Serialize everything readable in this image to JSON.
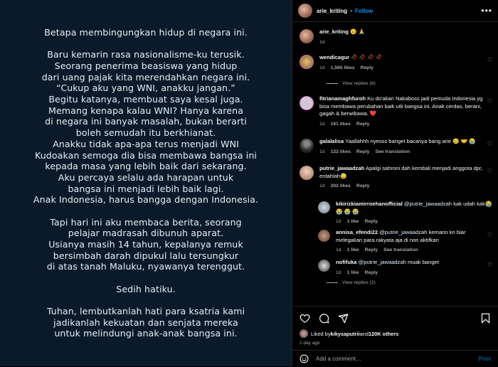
{
  "post": {
    "paragraphs": [
      "Betapa membingungkan hidup di negara ini.",
      "Baru kemarin rasa nasionalisme-ku terusik.\nSeorang penerima beasiswa yang hidup\ndari uang pajak kita merendahkan negara ini.\n“Cukup aku yang WNI, anakku jangan.”\nBegitu katanya, membuat saya kesal juga.\nMemang kenapa kalau WNI? Hanya karena\ndi negara ini banyak masalah, bukan berarti\nboleh semudah itu berkhianat.\nAnakku tidak apa-apa terus menjadi WNI\nKudoakan semoga dia bisa membawa bangsa ini\nkepada masa yang lebih baik dari sekarang.\nAku percaya selalu ada harapan untuk\nbangsa ini menjadi lebih baik lagi.\nAnak Indonesia, harus bangga dengan Indonesia.",
      "Tapi hari ini aku membaca berita, seorang\npelajar madrasah dibunuh aparat.\nUsianya masih 14 tahun, kepalanya remuk\nbersimbah darah dipukul lalu tersungkur\ndi atas tanah Maluku, nyawanya terenggut.",
      "Sedih hatiku.",
      "Tuhan, lembutkanlah hati para ksatria kami\njadikanlah kekuatan dan senjata mereka\nuntuk melindungi anak-anak bangsa ini."
    ]
  },
  "header": {
    "username": "arie_kriting",
    "dot": "•",
    "follow_label": "Follow",
    "more": "•••"
  },
  "caption": {
    "username": "arie_kriting",
    "text": "😐 🙏",
    "time": "1d"
  },
  "comments": [
    {
      "username": "wendicagur",
      "text": "🥀 🥀 🥀 🥀",
      "time": "1d",
      "likes": "1,565 likes",
      "reply": "Reply"
    },
    {
      "username": "fitrianamaghfuroh",
      "text": "Ku do'akan Nakaboss jadi pemuda Indonesia yg bisa membawa perubahan baik utk bangsa ini. Anak cerdas, berani, gagah & berwibawa. ❤️",
      "time": "1d",
      "likes": "161 likes",
      "reply": "Reply"
    },
    {
      "username": "galalalisa",
      "text": "Yaallahhh nyesss banget bacanya bang arie 😢 🤝 😭",
      "time": "1d",
      "likes": "122 likes",
      "reply": "Reply",
      "translate": "See translation"
    },
    {
      "username": "putrie_jawaadzah",
      "text": "Apalgi sahroni dah kembali menjadi anggota dpr, entahlah😓",
      "time": "1d",
      "likes": "202 likes",
      "reply": "Reply"
    }
  ],
  "view_replies_1": "View replies (6)",
  "replies": [
    {
      "username": "kikirizkiamirroehanofficial",
      "mention": "@putrie_jawaadzah",
      "text": "kak udah kak😭 😭 😭 😭",
      "time": "1d",
      "likes": "1 like",
      "reply": "Reply"
    },
    {
      "username": "annisa_efendi22",
      "mention": "@putrie_jawaadzah",
      "text": "kemarin kn biar melegakan para rakyata aja di non aktifkan",
      "time": "1d",
      "likes": "1 like",
      "reply": "Reply",
      "translate": "See translation"
    },
    {
      "username": "nofifuka",
      "mention": "@putrie_jawaadzah",
      "text": "muak banget",
      "time": "1d",
      "likes": "1 like",
      "reply": "Reply"
    }
  ],
  "view_replies_2": "View replies (2)",
  "likes_line": {
    "prefix": "Liked by ",
    "user": "kikysaputrii",
    "mid": " and ",
    "count": "120K others"
  },
  "posted_ago": "1 day ago",
  "add_comment": {
    "placeholder": "Add a comment…",
    "post_label": "Post"
  },
  "colors": {
    "accent": "#0095f6",
    "post_bg": "#0a1a2a"
  }
}
